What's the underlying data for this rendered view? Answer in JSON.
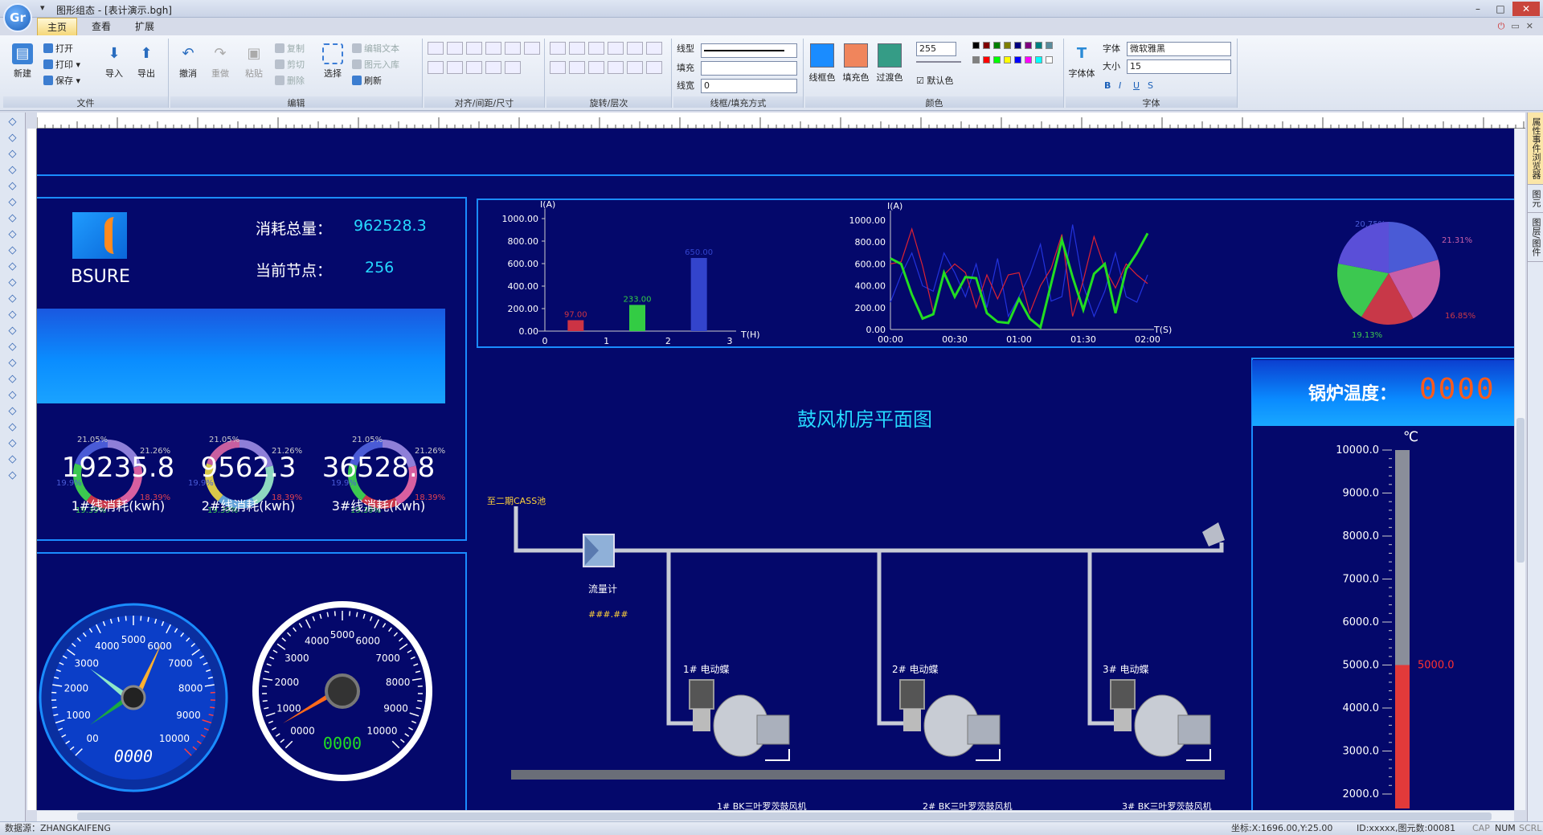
{
  "window": {
    "title": "图形组态 - [表计演示.bgh]",
    "logo": "Gr"
  },
  "tabs": [
    "主页",
    "查看",
    "扩展"
  ],
  "ribbon": {
    "file_group": {
      "label": "文件",
      "new": "新建",
      "open": "打开",
      "print": "打印",
      "save": "保存",
      "import": "导入",
      "export": "导出"
    },
    "edit_group": {
      "label": "编辑",
      "undo": "撤消",
      "redo": "重做",
      "paste": "粘贴",
      "copy": "复制",
      "cut": "剪切",
      "delete": "删除",
      "select": "选择",
      "edit_text": "编辑文本",
      "lib_in": "图元入库",
      "refresh": "刷新"
    },
    "align_group": {
      "label": "对齐/间距/尺寸"
    },
    "rotate_group": {
      "label": "旋转/层次"
    },
    "line_group": {
      "label": "线框/填充方式",
      "line_type": "线型",
      "fill": "填充",
      "line_width": "线宽",
      "line_width_value": "0"
    },
    "color_group": {
      "label": "颜色",
      "line_color": "线框色",
      "fill_color": "填充色",
      "gradient_color": "过渡色",
      "alpha": "255",
      "default_color": "默认色"
    },
    "font_group": {
      "label": "字体",
      "font_body": "字体体",
      "font_label": "字体",
      "font_value": "微软雅黑",
      "size_label": "大小",
      "size_value": "15"
    }
  },
  "side_panels": [
    "属性事件浏览器",
    "图元",
    "图层/图件"
  ],
  "status": {
    "datasource": "数据源：ZHANGKAIFENG",
    "coords": "坐标:X:1696.00,Y:25.00",
    "ids": "ID:xxxxx,图元数:00081",
    "caps": "CAP",
    "num": "NUM",
    "scrl": "SCRL"
  },
  "dashboard": {
    "brand": "BSURE",
    "total_label": "消耗总量：",
    "total_value": "962528.3",
    "node_label": "当前节点：",
    "node_value": "256",
    "lines": [
      {
        "value": "19235.8",
        "label": "1#线消耗(kwh)"
      },
      {
        "value": "9562.3",
        "label": "2#线消耗(kwh)"
      },
      {
        "value": "36528.8",
        "label": "3#线消耗(kwh)"
      }
    ],
    "donut_labels": [
      "21.05%",
      "21.26%",
      "18.39%",
      "19.39%",
      "19.9%"
    ],
    "gauge1": {
      "ticks": [
        "00",
        "1000",
        "2000",
        "3000",
        "4000",
        "5000",
        "6000",
        "7000",
        "8000",
        "9000",
        "10000"
      ],
      "readout": "0000"
    },
    "gauge2": {
      "ticks": [
        "0000",
        "1000",
        "2000",
        "3000",
        "4000",
        "5000",
        "6000",
        "7000",
        "8000",
        "9000",
        "10000"
      ],
      "readout": "0000"
    },
    "plan_title": "鼓风机房平面图",
    "pipe_label": "至二期CASS池",
    "meter_label": "流量计",
    "meter_value": "###.##",
    "valves": [
      "1# 电动蝶",
      "2# 电动蝶",
      "3# 电动蝶"
    ],
    "blowers": [
      "1# BK三叶罗茨鼓风机",
      "2# BK三叶罗茨鼓风机",
      "3# BK三叶罗茨鼓风机"
    ],
    "boiler_label": "锅炉温度：",
    "boiler_value": "0000",
    "thermo_unit": "℃",
    "thermo_ticks": [
      "10000.0",
      "9000.0",
      "8000.0",
      "7000.0",
      "6000.0",
      "5000.0",
      "4000.0",
      "3000.0",
      "2000.0"
    ],
    "thermo_marker": "5000.0"
  },
  "chart_data": [
    {
      "type": "bar",
      "ylabel": "I(A)",
      "xlabel": "T(H)",
      "categories": [
        "0",
        "1",
        "2",
        "3"
      ],
      "x_ticks": [
        "0",
        "1",
        "2",
        "3"
      ],
      "y_ticks": [
        "0.00",
        "200.00",
        "400.00",
        "600.00",
        "800.00",
        "1000.00"
      ],
      "ylim": [
        0,
        1000
      ],
      "bars": [
        {
          "x": 0.5,
          "value": 97.0,
          "label": "97.00",
          "color": "#cc3344"
        },
        {
          "x": 1.5,
          "value": 233.0,
          "label": "233.00",
          "color": "#33cc44"
        },
        {
          "x": 2.5,
          "value": 650.0,
          "label": "650.00",
          "color": "#3344cc"
        }
      ]
    },
    {
      "type": "line",
      "ylabel": "I(A)",
      "xlabel": "T(S)",
      "x_ticks": [
        "00:00",
        "00:30",
        "01:00",
        "01:30",
        "02:00"
      ],
      "y_ticks": [
        "0.00",
        "200.00",
        "400.00",
        "600.00",
        "800.00",
        "1000.00"
      ],
      "ylim": [
        0,
        1000
      ],
      "x": [
        0,
        5,
        10,
        15,
        20,
        25,
        30,
        35,
        40,
        45,
        50,
        55,
        60,
        65,
        70,
        75,
        80,
        85,
        90,
        95,
        100,
        105,
        110,
        115,
        120
      ],
      "series": [
        {
          "color": "#22dd22",
          "values": [
            650,
            600,
            320,
            100,
            140,
            520,
            300,
            480,
            470,
            150,
            70,
            60,
            280,
            100,
            20,
            420,
            820,
            480,
            180,
            510,
            600,
            150,
            550,
            700,
            880
          ]
        },
        {
          "color": "#dd2233",
          "values": [
            600,
            620,
            920,
            580,
            160,
            500,
            600,
            520,
            200,
            500,
            280,
            500,
            520,
            150,
            400,
            560,
            870,
            120,
            450,
            850,
            560,
            380,
            600,
            500,
            420
          ]
        },
        {
          "color": "#2233dd",
          "values": [
            250,
            500,
            700,
            400,
            350,
            700,
            520,
            300,
            600,
            200,
            650,
            120,
            300,
            500,
            780,
            260,
            300,
            960,
            400,
            120,
            350,
            700,
            300,
            250,
            500
          ]
        }
      ]
    },
    {
      "type": "pie",
      "slices": [
        {
          "value": 20.75,
          "label": "20.75%",
          "color": "#4a5bd6"
        },
        {
          "value": 21.31,
          "label": "21.31%",
          "color": "#c85fa8"
        },
        {
          "value": 16.85,
          "label": "16.85%",
          "color": "#c83848"
        },
        {
          "value": 19.13,
          "label": "19.13%",
          "color": "#3cc850"
        },
        {
          "value": 21.96,
          "label": "",
          "color": "#5a4fd8"
        }
      ]
    }
  ]
}
